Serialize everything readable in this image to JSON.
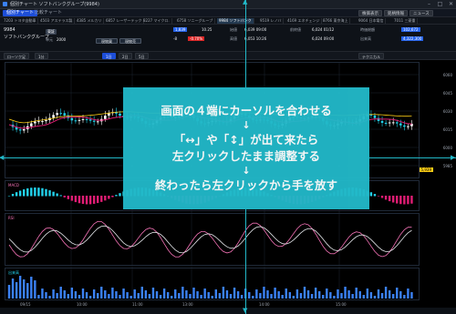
{
  "window": {
    "title": "個別チャート ソフトバンクグループ(9984)",
    "controls": [
      "minimize-icon",
      "maximize-icon",
      "close-icon"
    ]
  },
  "tabs": [
    {
      "label": "個別チャート",
      "active": true
    },
    {
      "label": "比較チャート",
      "active": false
    }
  ],
  "top_buttons": [
    "株価表示",
    "銘柄情報",
    "ニュース"
  ],
  "stock_tabs": [
    {
      "label": "7203 トヨタ自動車",
      "active": false
    },
    {
      "label": "4503 アステラス製",
      "active": false
    },
    {
      "label": "4385 メルカリ",
      "active": false
    },
    {
      "label": "6857 レーザーテック",
      "active": false
    },
    {
      "label": "8227 マイクロ.",
      "active": false
    },
    {
      "label": "6758 ソニーグループ",
      "active": false
    },
    {
      "label": "9984 ソフトバンク",
      "active": true
    },
    {
      "label": "9519 レノバ",
      "active": false
    },
    {
      "label": "4169 エネチェンジ",
      "active": false
    },
    {
      "label": "8766 東京海上",
      "active": false
    },
    {
      "label": "9064 日本電信",
      "active": false
    },
    {
      "label": "7011 三菱重",
      "active": false
    }
  ],
  "stock": {
    "code": "9984",
    "name": "ソフトバンクグループ",
    "market": "東証",
    "unit_label": "単元",
    "unit_value": "2000"
  },
  "quote": {
    "buy_label": "現物買",
    "sell_label": "現物売",
    "bid": "1,839",
    "change": "-8",
    "change_pct": "-0.70%",
    "extra": "10.25",
    "open_label": "始値",
    "open_value": "6,039 09:00",
    "high_label": "高値",
    "high_value": "6,053 10:26",
    "prev_label": "前終値",
    "prev_value": "6,024 01/12",
    "low_value": "6,024 09:00",
    "mcap_label": "時価総額",
    "mcap_value": "102,672",
    "volume_label": "出来高",
    "volume_value": "4,322,300"
  },
  "toolbar": {
    "chart_type": "ローソク足",
    "intervals": [
      {
        "label": "1分",
        "selected": false
      },
      {
        "label": "1日",
        "selected": true
      },
      {
        "label": "2日",
        "selected": false
      },
      {
        "label": "5日",
        "selected": false
      }
    ],
    "technical": "テクニカル"
  },
  "chart": {
    "price_ticks": [
      "6060",
      "6045",
      "6030",
      "6015",
      "6000",
      "5985"
    ],
    "price_tag": "5,939",
    "macd_label": "MACD",
    "rsi_label": "RSI",
    "volume_label": "出来高",
    "x_labels": [
      "09/15",
      "10:00",
      "11:00",
      "13:00",
      "14:00",
      "15:00"
    ],
    "colors": {
      "up": "#ffffff",
      "down": "#22d3ee",
      "ma": "#e11d74",
      "signal": "#facc15",
      "accent": "#22b8c8"
    }
  },
  "overlay": {
    "lines": [
      "画面の４端にカーソルを合わせる",
      "↓",
      "「↔」や「↕」が出て来たら",
      "左クリックしたまま調整する",
      "↓",
      "終わったら左クリックから手を放す"
    ]
  }
}
